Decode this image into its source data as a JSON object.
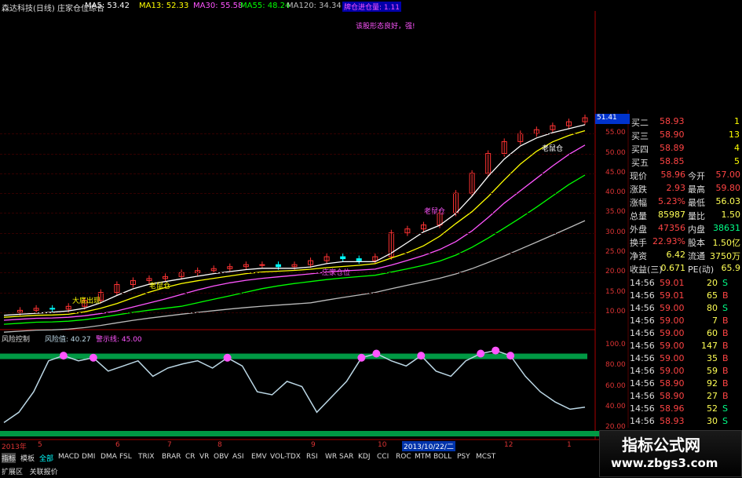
{
  "header": {
    "title": "森达科技(日线)",
    "indicator": "庄家仓位综合",
    "ma": [
      {
        "label": "MA5: 53.42",
        "color": "#ffffff"
      },
      {
        "label": "MA13: 52.33",
        "color": "#ffff00"
      },
      {
        "label": "MA30: 55.58",
        "color": "#ff55ff"
      },
      {
        "label": "MA55: 48.24",
        "color": "#00ff00"
      },
      {
        "label": "MA120: 34.34",
        "color": "#bbbbbb"
      }
    ],
    "signal_box": "牌仓进仓量: 1.11",
    "note": "该股形态良好，强!"
  },
  "price_axis": {
    "current": "51.41",
    "ticks": [
      "55.00",
      "50.00",
      "45.00",
      "40.00",
      "35.00",
      "30.00",
      "25.00",
      "20.00",
      "15.00",
      "10.00"
    ]
  },
  "annotations": {
    "big_low_a": "大底出现",
    "big_low_b": "老鼠仓",
    "rat_a": "老鼠仓",
    "rat_b": "庄家仓位",
    "rat_c": "老鼠仓"
  },
  "sub_panel": {
    "label": "风险控制",
    "value": "风险值: 40.27",
    "warn": "警示线: 45.00",
    "ticks": [
      "100.0",
      "80.00",
      "60.00",
      "40.00",
      "20.00"
    ]
  },
  "x_axis": {
    "labels": [
      "2013年",
      "5",
      "6",
      "7",
      "8",
      "9",
      "10",
      "2013/10/22/二",
      "12",
      "1"
    ]
  },
  "tabs": [
    "指标",
    "模板",
    "全部",
    "MACD",
    "DMI",
    "DMA",
    "FSL",
    "TRIX",
    "BRAR",
    "CR",
    "VR",
    "OBV",
    "ASI",
    "EMV",
    "VOL-TDX",
    "RSI",
    "WR",
    "SAR",
    "KDJ",
    "CCI",
    "ROC",
    "MTM",
    "BOLL",
    "PSY",
    "MCST"
  ],
  "bottom_tabs": [
    "扩展区",
    "关联报价"
  ],
  "quote": {
    "bids": [
      {
        "label": "买二",
        "price": "58.93",
        "vol": "1"
      },
      {
        "label": "买三",
        "price": "58.90",
        "vol": "13"
      },
      {
        "label": "买四",
        "price": "58.89",
        "vol": "4"
      },
      {
        "label": "买五",
        "price": "58.85",
        "vol": "5"
      }
    ],
    "stats": [
      {
        "k1": "现价",
        "v1": "58.96",
        "k2": "今开",
        "v2": "57.00"
      },
      {
        "k1": "涨跌",
        "v1": "2.93",
        "k2": "最高",
        "v2": "59.80"
      },
      {
        "k1": "涨幅",
        "v1": "5.23%",
        "k2": "最低",
        "v2": "56.03"
      },
      {
        "k1": "总量",
        "v1": "85987",
        "k2": "量比",
        "v2": "1.50"
      },
      {
        "k1": "外盘",
        "v1": "47356",
        "k2": "内盘",
        "v2": "38631"
      },
      {
        "k1": "换手",
        "v1": "22.93%",
        "k2": "股本",
        "v2": "1.50亿"
      },
      {
        "k1": "净资",
        "v1": "6.42",
        "k2": "流通",
        "v2": "3750万"
      },
      {
        "k1": "收益(三)",
        "v1": "0.671",
        "k2": "PE(动)",
        "v2": "65.9"
      }
    ],
    "ticks": [
      {
        "time": "14:56",
        "price": "59.01",
        "vol": "20",
        "side": "S"
      },
      {
        "time": "14:56",
        "price": "59.01",
        "vol": "65",
        "side": "B"
      },
      {
        "time": "14:56",
        "price": "59.00",
        "vol": "80",
        "side": "S"
      },
      {
        "time": "14:56",
        "price": "59.00",
        "vol": "7",
        "side": "B"
      },
      {
        "time": "14:56",
        "price": "59.00",
        "vol": "60",
        "side": "B"
      },
      {
        "time": "14:56",
        "price": "59.00",
        "vol": "147",
        "side": "B"
      },
      {
        "time": "14:56",
        "price": "59.00",
        "vol": "35",
        "side": "B"
      },
      {
        "time": "14:56",
        "price": "59.00",
        "vol": "59",
        "side": "B"
      },
      {
        "time": "14:56",
        "price": "58.90",
        "vol": "92",
        "side": "B"
      },
      {
        "time": "14:56",
        "price": "58.90",
        "vol": "27",
        "side": "B"
      },
      {
        "time": "14:56",
        "price": "58.96",
        "vol": "52",
        "side": "S"
      },
      {
        "time": "14:56",
        "price": "58.93",
        "vol": "30",
        "side": "S"
      }
    ]
  },
  "watermark": {
    "title": "指标公式网",
    "url": "www.zbgs3.com"
  },
  "colors": {
    "up": "#ff3333",
    "down": "#00ffff",
    "axis": "#aa0000",
    "band": "#009944",
    "risk_line": "#bcd8e6"
  },
  "chart_data": {
    "type": "line",
    "series": [
      {
        "values": [
          10,
          10.5,
          11,
          10.8,
          11.5,
          13,
          15,
          17,
          18,
          18.5,
          19,
          20,
          20.5,
          21,
          21.5,
          22,
          22,
          21.5,
          22,
          23,
          24,
          23.5,
          23,
          24,
          30,
          31,
          32,
          35,
          40,
          45,
          50,
          53,
          55,
          56,
          57,
          58,
          59
        ]
      }
    ],
    "risk": [
      25,
      35,
      55,
      85,
      90,
      85,
      88,
      75,
      80,
      85,
      70,
      78,
      82,
      85,
      78,
      88,
      80,
      55,
      52,
      65,
      60,
      35,
      50,
      65,
      88,
      92,
      85,
      80,
      90,
      75,
      70,
      85,
      92,
      95,
      90,
      70,
      55,
      45,
      38,
      40
    ],
    "ylim": [
      8,
      60
    ],
    "risk_ylim": [
      20,
      100
    ]
  }
}
